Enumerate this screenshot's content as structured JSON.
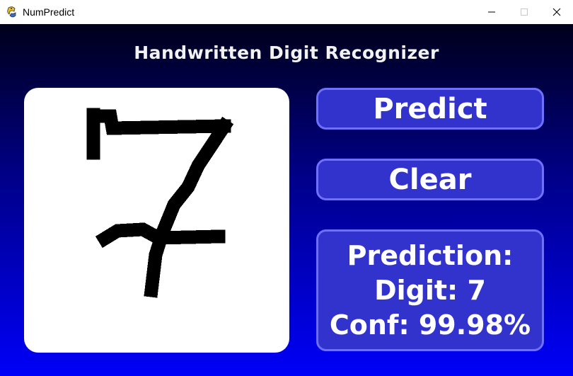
{
  "window": {
    "title": "NumPredict",
    "icons": {
      "app": "python-snake-icon",
      "minimize": "minimize-icon",
      "maximize": "maximize-icon",
      "close": "close-icon"
    }
  },
  "app": {
    "heading": "Handwritten Digit Recognizer"
  },
  "buttons": {
    "predict_label": "Predict",
    "clear_label": "Clear"
  },
  "result": {
    "line1": "Prediction:",
    "line2": "Digit: 7",
    "line3": "Conf: 99.98%"
  },
  "colors": {
    "gradient_top": "#00001a",
    "gradient_bottom": "#0000f8",
    "button_fill": "#3232cc",
    "button_border": "#7070ff",
    "canvas_bg": "#ffffff",
    "ink": "#000000"
  }
}
